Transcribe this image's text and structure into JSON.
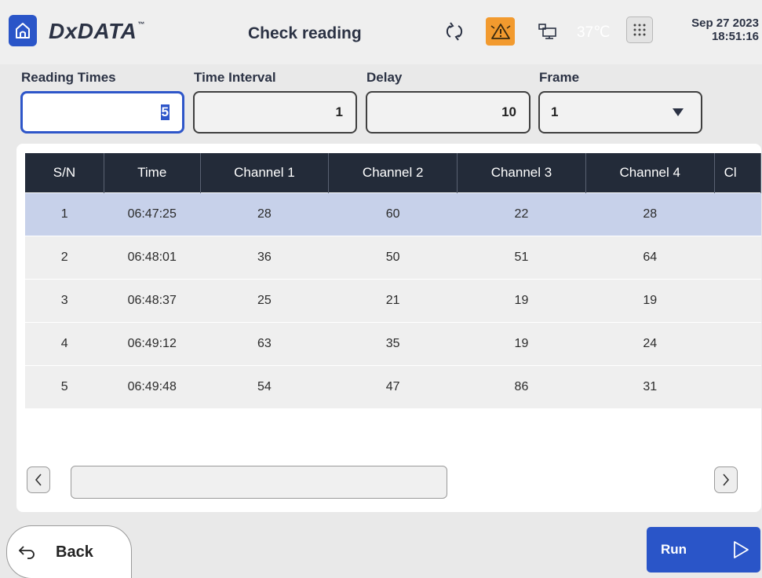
{
  "header": {
    "logo": "DxDATA",
    "logo_tm": "™",
    "title": "Check reading",
    "temperature": "37℃",
    "date": "Sep 27 2023",
    "time": "18:51:16",
    "icons": [
      "home-icon",
      "sync-icon",
      "warning-icon",
      "pc-connection-icon",
      "keypad-icon"
    ]
  },
  "form": {
    "reading_times": {
      "label": "Reading Times",
      "value": "5"
    },
    "time_interval": {
      "label": "Time Interval",
      "value": "1"
    },
    "delay": {
      "label": "Delay",
      "value": "10"
    },
    "frame": {
      "label": "Frame",
      "value": "1"
    }
  },
  "table": {
    "columns": [
      "S/N",
      "Time",
      "Channel 1",
      "Channel 2",
      "Channel 3",
      "Channel 4",
      "Cl"
    ],
    "rows": [
      [
        "1",
        "06:47:25",
        "28",
        "60",
        "22",
        "28",
        ""
      ],
      [
        "2",
        "06:48:01",
        "36",
        "50",
        "51",
        "64",
        ""
      ],
      [
        "3",
        "06:48:37",
        "25",
        "21",
        "19",
        "19",
        ""
      ],
      [
        "4",
        "06:49:12",
        "63",
        "35",
        "19",
        "24",
        ""
      ],
      [
        "5",
        "06:49:48",
        "54",
        "47",
        "86",
        "31",
        ""
      ]
    ]
  },
  "footer": {
    "back_label": "Back",
    "run_label": "Run"
  },
  "colors": {
    "accent": "#2a55c8",
    "header_row": "#232b39",
    "selected_row": "#c7d1ea",
    "warning": "#f29a2e"
  }
}
